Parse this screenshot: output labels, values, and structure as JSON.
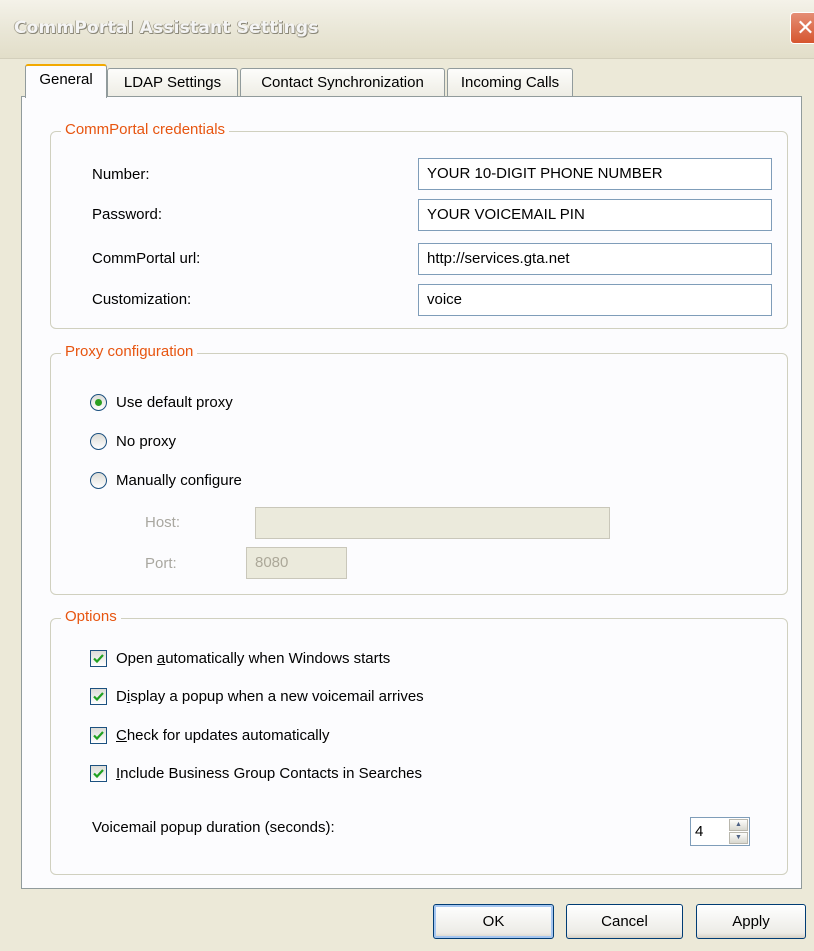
{
  "window": {
    "title": "CommPortal Assistant Settings",
    "close_glyph": "✕"
  },
  "tabs": [
    {
      "label": "General"
    },
    {
      "label": "LDAP Settings"
    },
    {
      "label": "Contact Synchronization"
    },
    {
      "label": "Incoming Calls"
    }
  ],
  "credentials": {
    "title": "CommPortal credentials",
    "number_label": "Number:",
    "number_value": "YOUR 10-DIGIT PHONE NUMBER",
    "password_label": "Password:",
    "password_value": "YOUR VOICEMAIL PIN",
    "url_label": "CommPortal url:",
    "url_value": "http://services.gta.net",
    "customization_label": "Customization:",
    "customization_value": "voice"
  },
  "proxy": {
    "title": "Proxy configuration",
    "default_label": "Use default proxy",
    "none_label": "No proxy",
    "manual_label": "Manually configure",
    "selected": "default",
    "host_label": "Host:",
    "host_value": "",
    "port_label": "Port:",
    "port_value": "8080"
  },
  "options": {
    "title": "Options",
    "items": [
      {
        "pre": "Open ",
        "key": "a",
        "post": "utomatically when Windows starts",
        "checked": true
      },
      {
        "pre": "D",
        "key": "i",
        "post": "splay a popup when a new voicemail arrives",
        "checked": true
      },
      {
        "pre": "",
        "key": "C",
        "post": "heck for updates automatically",
        "checked": true
      },
      {
        "pre": "",
        "key": "I",
        "post": "nclude Business Group Contacts in Searches",
        "checked": true
      }
    ],
    "duration_label": "Voicemail popup duration (seconds):",
    "duration_value": "4"
  },
  "buttons": {
    "ok": "OK",
    "cancel": "Cancel",
    "apply": "Apply"
  },
  "colors": {
    "accent_orange": "#E75510",
    "tab_highlight": "#F2A900",
    "check_green": "#2B9F22",
    "close_red": "#D6552F"
  }
}
